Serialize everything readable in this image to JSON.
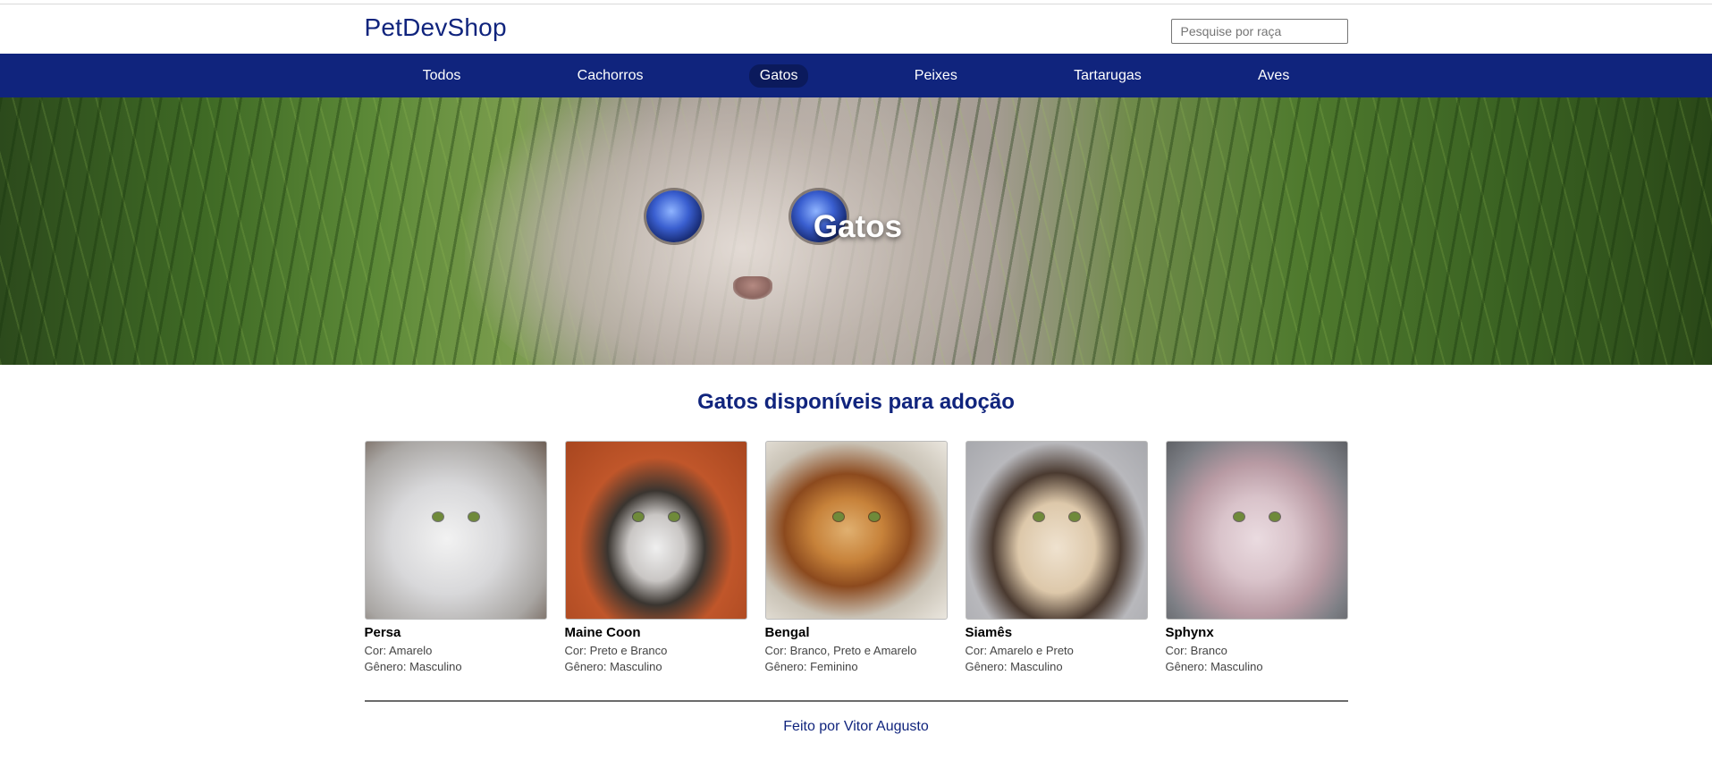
{
  "header": {
    "brand": "PetDevShop",
    "search_placeholder": "Pesquise por raça"
  },
  "nav": {
    "items": [
      {
        "label": "Todos"
      },
      {
        "label": "Cachorros"
      },
      {
        "label": "Gatos",
        "active": true
      },
      {
        "label": "Peixes"
      },
      {
        "label": "Tartarugas"
      },
      {
        "label": "Aves"
      }
    ]
  },
  "hero": {
    "title": "Gatos"
  },
  "main": {
    "title": "Gatos disponíveis para adoção",
    "cards": [
      {
        "name": "Persa",
        "cor": "Cor: Amarelo",
        "genero": "Gênero: Masculino"
      },
      {
        "name": "Maine Coon",
        "cor": "Cor: Preto e Branco",
        "genero": "Gênero: Masculino"
      },
      {
        "name": "Bengal",
        "cor": "Cor: Branco, Preto e Amarelo",
        "genero": "Gênero: Feminino"
      },
      {
        "name": "Siamês",
        "cor": "Cor: Amarelo e Preto",
        "genero": "Gênero: Masculino"
      },
      {
        "name": "Sphynx",
        "cor": "Cor: Branco",
        "genero": "Gênero: Masculino"
      }
    ]
  },
  "footer": {
    "text": "Feito por Vitor Augusto"
  },
  "colors": {
    "brand": "#10247d",
    "nav_bg": "#10247d",
    "nav_active_bg": "#0b1a5c"
  }
}
